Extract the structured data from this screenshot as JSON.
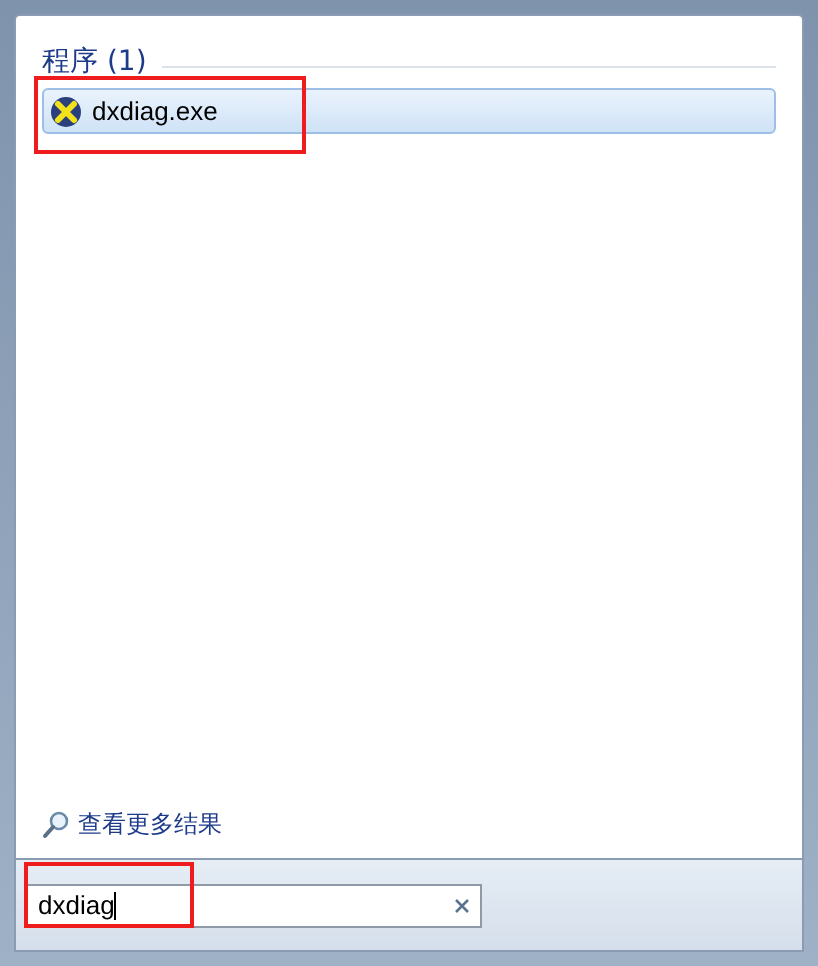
{
  "results": {
    "heading": "程序 (1)",
    "items": [
      {
        "label": "dxdiag.exe",
        "selected": true
      }
    ]
  },
  "see_more": "查看更多结果",
  "search": {
    "value": "dxdiag"
  }
}
